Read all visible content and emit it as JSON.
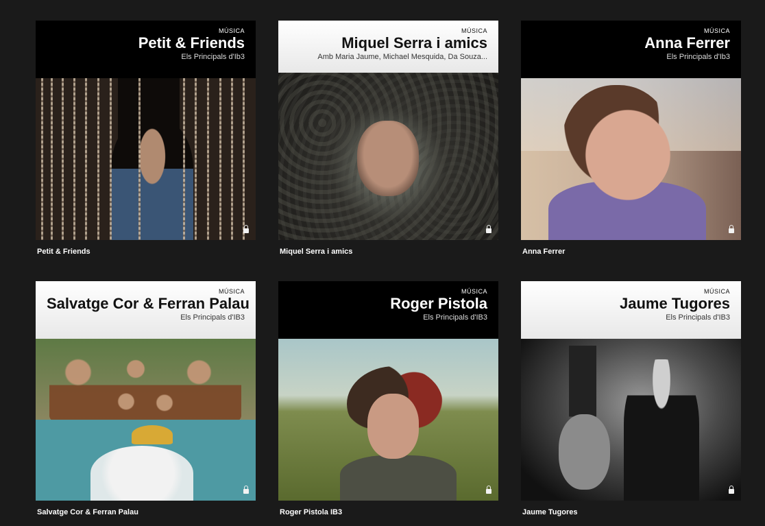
{
  "cards": [
    {
      "kicker": "MÚSICA",
      "title": "Petit & Friends",
      "subtitle": "Els Principals d'Ib3",
      "caption": "Petit & Friends",
      "header_style": "dark",
      "lock_icon": "lock-icon"
    },
    {
      "kicker": "MÚSICA",
      "title": "Miquel Serra i amics",
      "subtitle": "Amb Maria Jaume, Michael Mesquida, Da Souza...",
      "caption": "Miquel Serra i amics",
      "header_style": "light",
      "lock_icon": "lock-icon"
    },
    {
      "kicker": "MÚSICA",
      "title": "Anna Ferrer",
      "subtitle": "Els Principals d'Ib3",
      "caption": "Anna Ferrer",
      "header_style": "dark",
      "lock_icon": "lock-icon"
    },
    {
      "kicker": "MÚSICA",
      "title": "Salvatge Cor & Ferran Palau",
      "subtitle": "Els Principals d'IB3",
      "caption": "Salvatge Cor & Ferran Palau",
      "header_style": "light",
      "lock_icon": "lock-icon"
    },
    {
      "kicker": "MÚSICA",
      "title": "Roger Pistola",
      "subtitle": "Els Principals d'IB3",
      "caption": "Roger Pistola IB3",
      "header_style": "dark",
      "lock_icon": "lock-icon"
    },
    {
      "kicker": "MÚSICA",
      "title": "Jaume Tugores",
      "subtitle": "Els Principals d'IB3",
      "caption": "Jaume Tugores",
      "header_style": "light",
      "lock_icon": "lock-icon"
    }
  ],
  "colors": {
    "page_bg": "#1a1a1a",
    "dark_header": "#000000",
    "light_header": "#ffffff"
  }
}
